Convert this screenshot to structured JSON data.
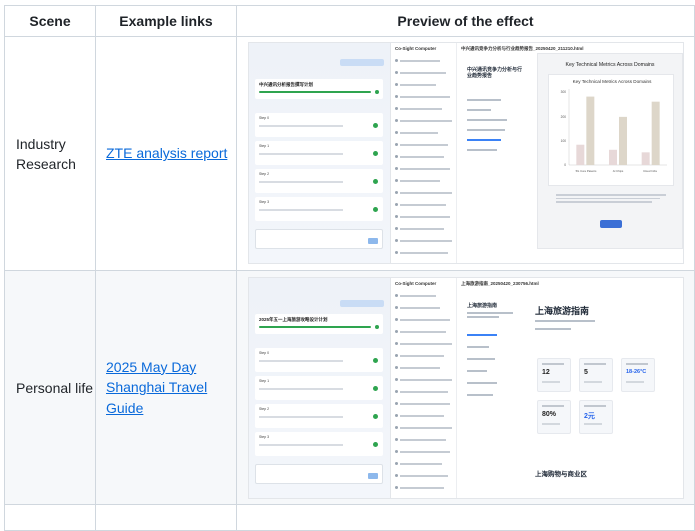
{
  "table": {
    "headers": [
      "Scene",
      "Example links",
      "Preview of the effect"
    ],
    "rows": [
      {
        "scene": "Industry Research",
        "link": "ZTE analysis report",
        "preview": {
          "mid_header": "Co-Sight Computer",
          "right_header": "中兴通讯竞争力分析与行业趋势报告_20250420_211210.html",
          "task_title": "中兴通讯分析报告撰写计划",
          "steps": [
            "Step 0",
            "Step 1",
            "Step 2",
            "Step 3"
          ],
          "doc_title": "中兴通讯竞争力分析与行业趋势报告",
          "chart_card_title": "Key Technical Metrics Across Domains",
          "inner_chart_title": "Key Technical Metrics Across Domains",
          "y_ticks": [
            "300",
            "200",
            "100",
            "0"
          ],
          "x_labels": [
            "5G Core Patents",
            "AI Chips",
            "Cloud Infra"
          ]
        }
      },
      {
        "scene": "Personal life",
        "link": "2025 May Day Shanghai Travel Guide",
        "preview": {
          "mid_header": "Co-Sight Computer",
          "right_header": "上海旅游指南_20250420_230756.html",
          "task_title": "2025年五一上海旅游攻略设计计划",
          "steps": [
            "Step 0",
            "Step 1",
            "Step 2",
            "Step 3"
          ],
          "doc_title": "上海旅游指南",
          "travel_title": "上海旅游指南",
          "stats": [
            "12",
            "5",
            "18-26°C",
            "80%",
            "2元"
          ],
          "section_title": "上海购物与商业区"
        }
      }
    ]
  },
  "chart_data": {
    "type": "bar",
    "title": "Key Technical Metrics Across Domains",
    "categories": [
      "5G Core Patents",
      "AI Chips",
      "Cloud Infra"
    ],
    "series": [
      {
        "values": [
          80,
          60,
          50
        ]
      },
      {
        "values": [
          270,
          190,
          250
        ]
      }
    ],
    "ylim": [
      0,
      300
    ]
  },
  "colors": {
    "link": "#0969da",
    "border": "#d0d7de",
    "bar_a": "#e7d8d8",
    "bar_b": "#ddd6c9"
  }
}
